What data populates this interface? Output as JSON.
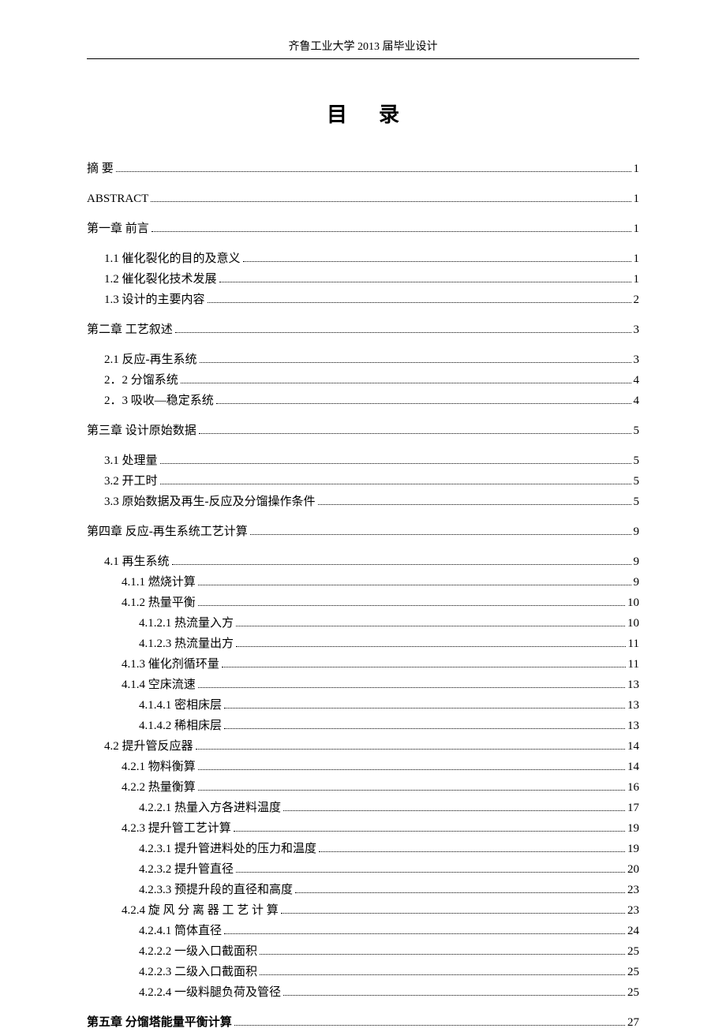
{
  "header": "齐鲁工业大学 2013 届毕业设计",
  "title": "目录",
  "toc": [
    {
      "label": "摘   要",
      "page": "1",
      "level": 0,
      "gap": false
    },
    {
      "label": "ABSTRACT",
      "page": "1",
      "level": 0,
      "gap": true
    },
    {
      "label": "第一章  前言",
      "page": "1",
      "level": 0,
      "gap": true
    },
    {
      "label": "1.1 催化裂化的目的及意义",
      "page": "1",
      "level": 1,
      "gap": true
    },
    {
      "label": "1.2 催化裂化技术发展",
      "page": "1",
      "level": 1,
      "gap": false
    },
    {
      "label": "1.3 设计的主要内容",
      "page": "2",
      "level": 1,
      "gap": false
    },
    {
      "label": "第二章  工艺叙述",
      "page": "3",
      "level": 0,
      "gap": true
    },
    {
      "label": "2.1 反应-再生系统",
      "page": "3",
      "level": 1,
      "gap": true
    },
    {
      "label": "2．2 分馏系统",
      "page": "4",
      "level": 1,
      "gap": false
    },
    {
      "label": "2．3 吸收—稳定系统",
      "page": "4",
      "level": 1,
      "gap": false
    },
    {
      "label": "第三章    设计原始数据",
      "page": "5",
      "level": 0,
      "gap": true
    },
    {
      "label": "3.1 处理量",
      "page": "5",
      "level": 1,
      "gap": true,
      "labelPad": "    "
    },
    {
      "label": "3.2 开工时",
      "page": "5",
      "level": 1,
      "gap": false,
      "labelPad": "    "
    },
    {
      "label": "3.3 原始数据及再生-反应及分馏操作条件",
      "page": "5",
      "level": 1,
      "gap": false
    },
    {
      "label": "第四章    反应-再生系统工艺计算",
      "page": "9",
      "level": 0,
      "gap": true
    },
    {
      "label": "4.1     再生系统",
      "page": "9",
      "level": 1,
      "gap": true
    },
    {
      "label": "4.1.1   燃烧计算",
      "page": "9",
      "level": 2,
      "gap": false
    },
    {
      "label": "4.1.2 热量平衡",
      "page": "10",
      "level": 2,
      "gap": false
    },
    {
      "label": "4.1.2.1   热流量入方",
      "page": "10",
      "level": 3,
      "gap": false
    },
    {
      "label": "4.1.2.3   热流量出方",
      "page": "11",
      "level": 3,
      "gap": false
    },
    {
      "label": "4.1.3 催化剂循环量",
      "page": "11",
      "level": 2,
      "gap": false
    },
    {
      "label": "4.1.4 空床流速",
      "page": "13",
      "level": 2,
      "gap": false
    },
    {
      "label": "4.1.4.1 密相床层",
      "page": "13",
      "level": 3,
      "gap": false
    },
    {
      "label": "4.1.4.2  稀相床层",
      "page": "13",
      "level": 3,
      "gap": false
    },
    {
      "label": "4.2 提升管反应器",
      "page": "14",
      "level": 1,
      "gap": false
    },
    {
      "label": "4.2.1  物料衡算",
      "page": "14",
      "level": 2,
      "gap": false
    },
    {
      "label": "4.2.2 热量衡算",
      "page": "16",
      "level": 2,
      "gap": false
    },
    {
      "label": "4.2.2.1 热量入方各进料温度",
      "page": "17",
      "level": 3,
      "gap": false
    },
    {
      "label": "4.2.3  提升管工艺计算",
      "page": "19",
      "level": 2,
      "gap": false
    },
    {
      "label": "4.2.3.1 提升管进料处的压力和温度",
      "page": "19",
      "level": 3,
      "gap": false
    },
    {
      "label": "4.2.3.2 提升管直径",
      "page": "20",
      "level": 3,
      "gap": false
    },
    {
      "label": "4.2.3.3  预提升段的直径和高度",
      "page": "23",
      "level": 3,
      "gap": false
    },
    {
      "label": "4.2.4 旋 风 分 离 器 工 艺 计 算",
      "page": "23",
      "level": 2,
      "gap": false
    },
    {
      "label": "4.2.4.1  筒体直径",
      "page": "24",
      "level": 3,
      "gap": false
    },
    {
      "label": "4.2.2.2 一级入口截面积",
      "page": "25",
      "level": 3,
      "gap": false
    },
    {
      "label": "4.2.2.3  二级入口截面积",
      "page": "25",
      "level": 3,
      "gap": false
    },
    {
      "label": "4.2.2.4 一级料腿负荷及管径",
      "page": "25",
      "level": 3,
      "gap": false
    },
    {
      "label": "第五章    分馏塔能量平衡计算",
      "page": "27",
      "level": 0,
      "gap": true,
      "bold": true
    }
  ]
}
